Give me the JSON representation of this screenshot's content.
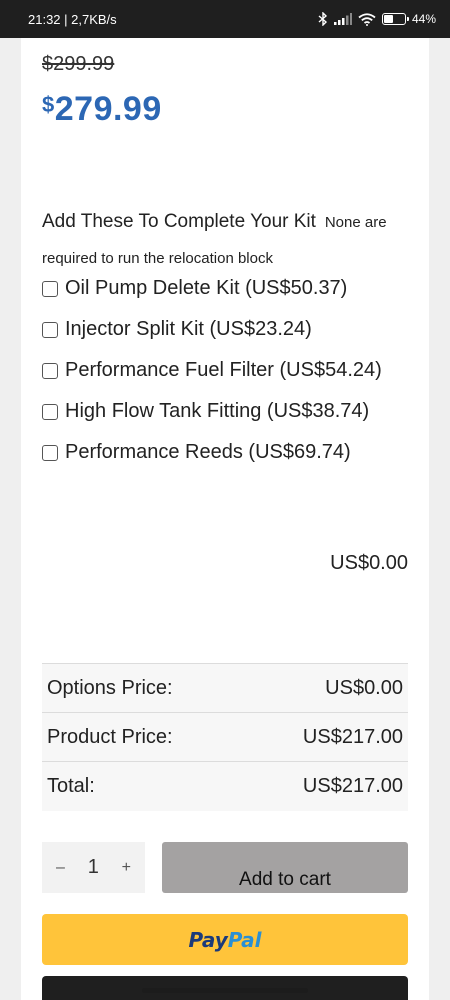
{
  "status_bar": {
    "time_speed": "21:32 | 2,7KB/s",
    "battery": "44",
    "battery_unit": "%",
    "battery_level": 0.44,
    "icons": [
      "bluetooth-icon",
      "signal-icon",
      "wifi-icon",
      "battery-icon"
    ]
  },
  "product": {
    "old_price": "$299.99",
    "price_currency": "$",
    "price_value": "279.99"
  },
  "kit": {
    "title": "Add These To Complete Your Kit",
    "note": "None are required to run the relocation block",
    "options": [
      {
        "label": "Oil Pump Delete Kit (US$50.37)",
        "checked": false
      },
      {
        "label": "Injector Split Kit (US$23.24)",
        "checked": false
      },
      {
        "label": "Performance Fuel Filter (US$54.24)",
        "checked": false
      },
      {
        "label": "High Flow Tank Fitting (US$38.74)",
        "checked": false
      },
      {
        "label": "Performance Reeds (US$69.74)",
        "checked": false
      }
    ],
    "options_total": "US$0.00"
  },
  "summary": {
    "rows": [
      {
        "label": "Options Price:",
        "value": "US$0.00"
      },
      {
        "label": "Product Price:",
        "value": "US$217.00"
      },
      {
        "label": "Total:",
        "value": "US$217.00"
      }
    ]
  },
  "cart": {
    "minus": "–",
    "quantity": "1",
    "plus": "+",
    "add_label": "Add to cart"
  },
  "paypal": {
    "part1": "Pay",
    "part2": "Pal"
  },
  "colors": {
    "price_blue": "#2c67b4",
    "paypal_yellow": "#ffc43a",
    "add_cart_gray": "#a4a2a2"
  }
}
